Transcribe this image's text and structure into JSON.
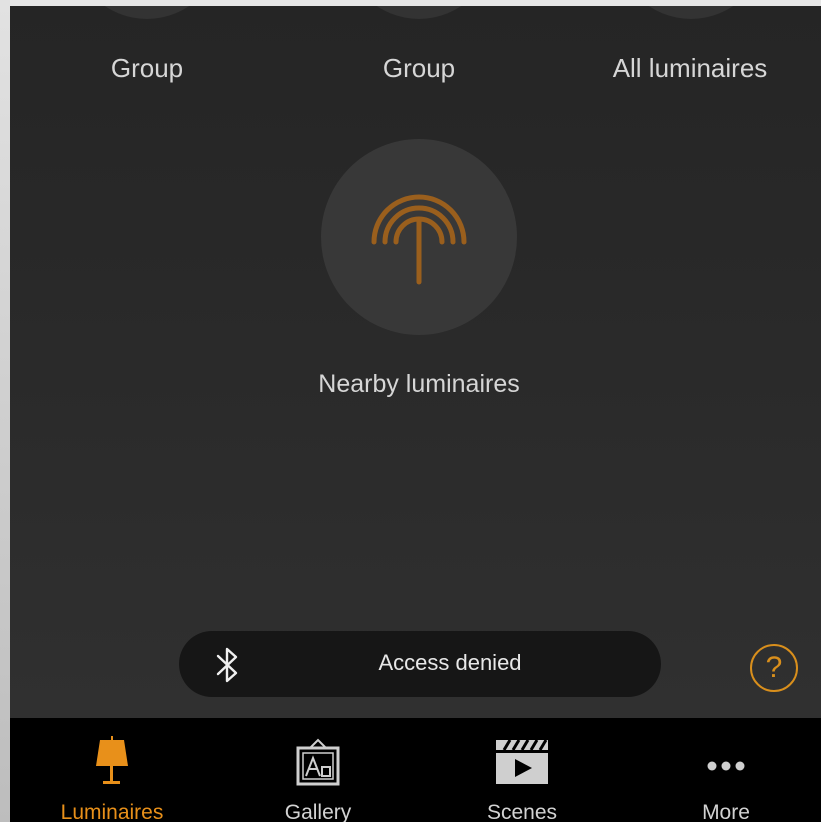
{
  "groups": [
    {
      "label": "Group"
    },
    {
      "label": "Group"
    },
    {
      "label": "All luminaires"
    }
  ],
  "nearby": {
    "label": "Nearby luminaires",
    "icon": "antenna-signal-icon"
  },
  "status": {
    "message": "Access denied",
    "icon": "bluetooth-icon"
  },
  "help": {
    "label": "?",
    "icon": "help-icon"
  },
  "tabs": [
    {
      "label": "Luminaires",
      "icon": "lamp-icon",
      "active": true
    },
    {
      "label": "Gallery",
      "icon": "picture-frame-icon",
      "active": false
    },
    {
      "label": "Scenes",
      "icon": "clapperboard-icon",
      "active": false
    },
    {
      "label": "More",
      "icon": "more-dots-icon",
      "active": false
    }
  ],
  "colors": {
    "accent": "#e8901a",
    "background": "#2a2a2a",
    "tabbar": "#000000"
  }
}
